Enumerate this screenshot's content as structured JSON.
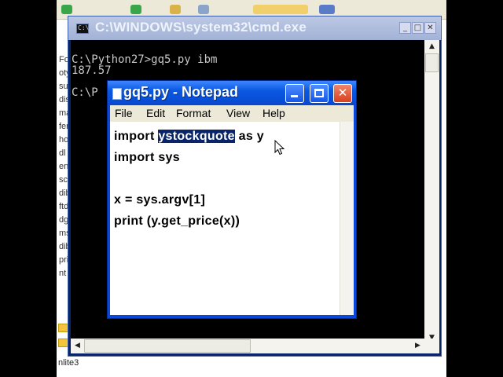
{
  "background": {
    "left_fragments": [
      "Fo",
      "oty",
      "sui",
      "dis",
      "ma",
      "fen",
      "hor",
      "dl",
      "en",
      "sc",
      "dib",
      "ftd",
      "dg",
      "ms",
      "dib",
      "pri",
      "nt"
    ],
    "bottom_text": "nlite3"
  },
  "cmd_window": {
    "title": "C:\\WINDOWS\\system32\\cmd.exe",
    "icon_glyph": "C:\\",
    "console_lines": [
      "C:\\Python27>gq5.py ibm",
      "187.57",
      "",
      "C:\\P"
    ],
    "buttons": {
      "minimize": "_",
      "maximize": "□",
      "close": "✕"
    },
    "scroll_arrows": {
      "up": "▲",
      "down": "▼",
      "left": "◀",
      "right": "▶"
    }
  },
  "notepad": {
    "title": "gq5.py - Notepad",
    "menu": [
      "File",
      "Edit",
      "Format",
      "View",
      "Help"
    ],
    "close_label": "✕",
    "lines": {
      "line1_pre": "import ",
      "line1_sel": "ystockquote",
      "line1_post": " as y",
      "line2": "import sys",
      "line3": "",
      "line4": "x = sys.argv[1]",
      "line5": "print (y.get_price(x))"
    },
    "colors": {
      "titlebar": "#0a58e2",
      "selection": "#0a246a",
      "close_button": "#d8401e"
    }
  }
}
